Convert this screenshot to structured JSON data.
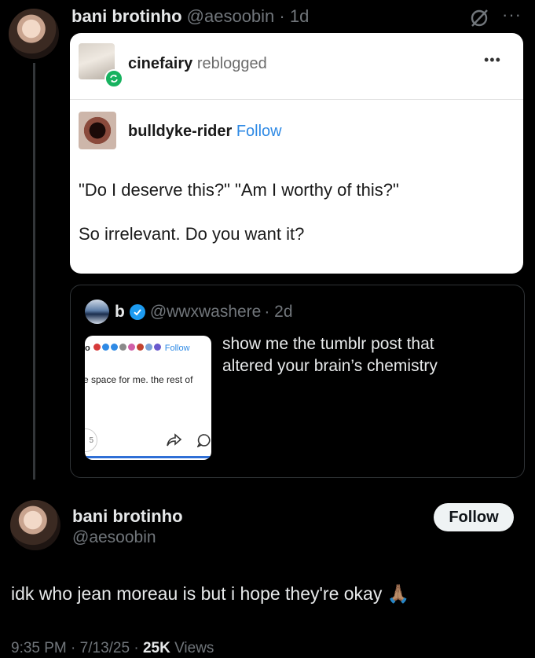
{
  "tweet": {
    "author_name": "bani brotinho",
    "author_handle": "@aesoobin",
    "age": "· 1d",
    "more": "···"
  },
  "tumblr_card": {
    "reblogger": "cinefairy",
    "reblogged_text": "reblogged",
    "menu": "•••",
    "poster": "bulldyke-rider",
    "follow": "Follow",
    "line1": "\"Do I deserve this?\" \"Am I worthy of this?\"",
    "line2": "So irrelevant. Do you want it?"
  },
  "quoted": {
    "name": "b",
    "handle": "@wwxwashere",
    "age": "· 2d",
    "text_line1": "show me the tumblr post that",
    "text_line2": "altered your brain’s chemistry",
    "thumb_header_left": "o",
    "thumb_follow": "Follow",
    "thumb_body": "e space for me. the rest of",
    "thumb_counter": "5"
  },
  "reply": {
    "name": "bani brotinho",
    "handle": "@aesoobin",
    "follow": "Follow",
    "text": "idk who jean moreau is but i hope they're  okay",
    "emoji": "🙏🏽",
    "time": "9:35 PM",
    "date": "· 7/13/25 ·",
    "views_count": "25K",
    "views_label": "Views"
  },
  "colors": {
    "tumblr_blue": "#2f8ae5",
    "verified_blue": "#1d9bf0",
    "repost_green": "#17b25f"
  }
}
